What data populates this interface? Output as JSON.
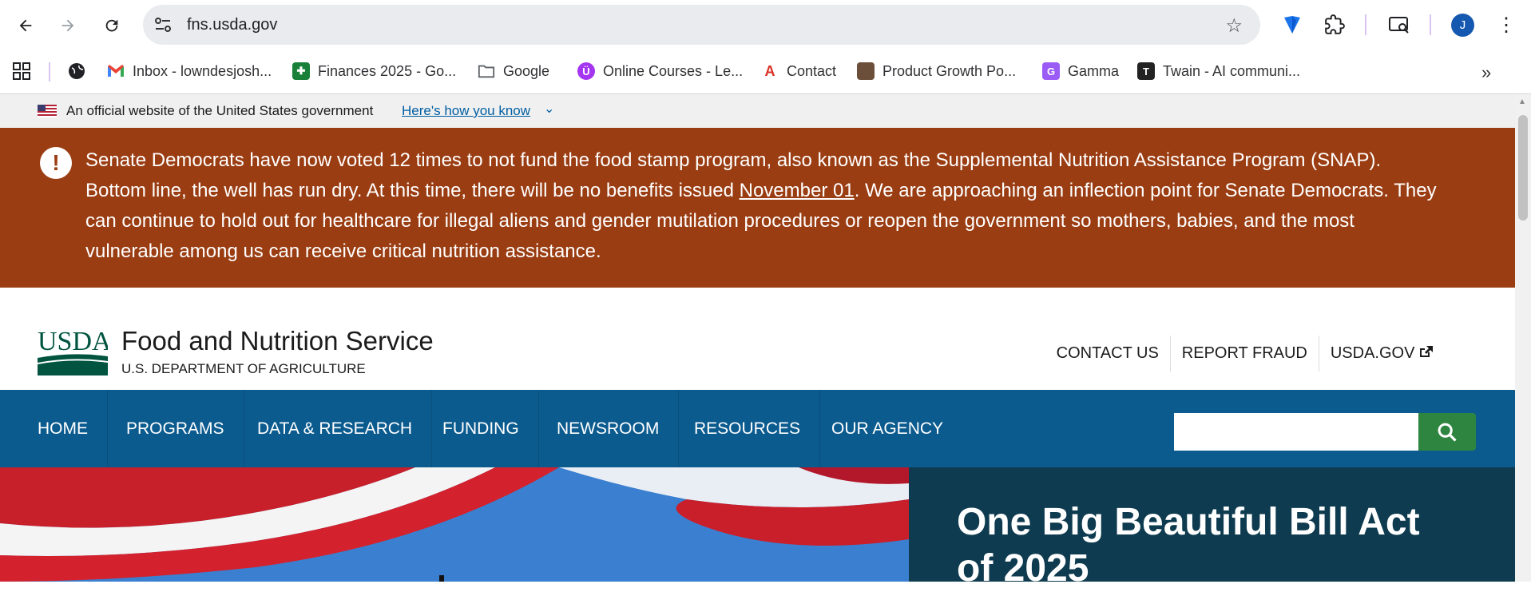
{
  "browser": {
    "url": "fns.usda.gov",
    "avatar_initial": "J",
    "bookmarks": [
      {
        "label": "Inbox - lowndesjosh...",
        "icon": "gmail-icon",
        "color": "#ea4335"
      },
      {
        "label": "Finances 2025 - Go...",
        "icon": "sheets-icon",
        "color": "#188038"
      },
      {
        "label": "Google",
        "icon": "folder-icon",
        "color": "#5f6368"
      },
      {
        "label": "Online Courses - Le...",
        "icon": "udemy-icon",
        "color": "#a435f0"
      },
      {
        "label": "Contact",
        "icon": "contact-icon",
        "color": "#d93025"
      },
      {
        "label": "Product Growth Po...",
        "icon": "podcast-icon",
        "color": "#6b4f3a"
      },
      {
        "label": "Gamma",
        "icon": "gamma-icon",
        "color": "#9b5cf6"
      },
      {
        "label": "Twain - AI communi...",
        "icon": "twain-icon",
        "color": "#222222"
      }
    ]
  },
  "gov_banner": {
    "text": "An official website of the United States government",
    "link": "Here's how you know"
  },
  "alert": {
    "text_before": "Senate Democrats have now voted 12 times to not fund the food stamp program, also known as the Supplemental Nutrition Assistance Program (SNAP). Bottom line, the well has run dry. At this time, there will be no benefits issued ",
    "date_link": "November 01",
    "text_after": ". We are approaching an inflection point for Senate Democrats. They can continue to hold out for healthcare for illegal aliens and gender mutilation procedures or reopen the government so mothers, babies, and the most vulnerable among us can receive critical nutrition assistance."
  },
  "header": {
    "logo_text": "USDA",
    "agency_name": "Food and Nutrition Service",
    "agency_sub": "U.S. DEPARTMENT OF AGRICULTURE",
    "utility_links": [
      "CONTACT US",
      "REPORT FRAUD",
      "USDA.GOV"
    ]
  },
  "nav": {
    "items": [
      "HOME",
      "PROGRAMS",
      "DATA & RESEARCH",
      "FUNDING",
      "NEWSROOM",
      "RESOURCES",
      "OUR AGENCY"
    ],
    "search_placeholder": ""
  },
  "hero": {
    "title": "One Big Beautiful Bill Act of 2025"
  },
  "colors": {
    "alert_bg": "#9b3d12",
    "nav_bg": "#0b5b8f",
    "search_btn": "#2e8540",
    "hero_panel": "#0e3b4f",
    "link": "#005ea2"
  }
}
